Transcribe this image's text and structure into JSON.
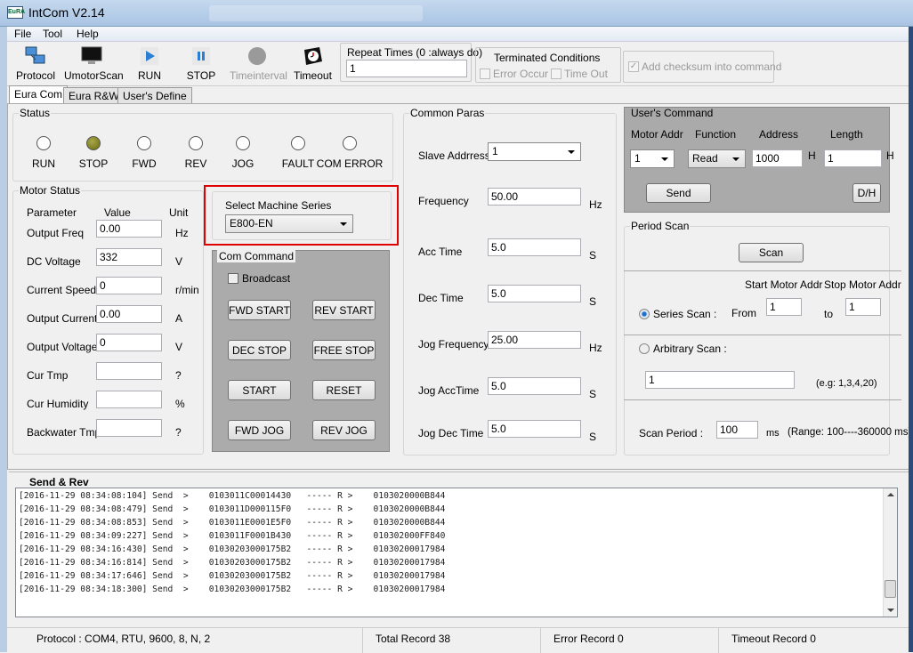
{
  "window": {
    "title": "IntCom V2.14",
    "logo_text": "EuRA"
  },
  "menu": [
    "File",
    "Tool",
    "Help"
  ],
  "toolbar": {
    "buttons": [
      {
        "label": "Protocol",
        "icon": "network-icon"
      },
      {
        "label": "UmotorScan",
        "icon": "monitor-icon"
      },
      {
        "label": "RUN",
        "icon": "play-icon"
      },
      {
        "label": "STOP",
        "icon": "pause-icon"
      },
      {
        "label": "Timeinterval",
        "icon": "circle-icon",
        "disabled": true
      },
      {
        "label": "Timeout",
        "icon": "clock-icon"
      }
    ],
    "repeat_label": "Repeat Times (0 :always do)",
    "repeat_value": "1",
    "terminated_label": "Terminated Conditions",
    "error_occur": "Error Occur",
    "time_out": "Time Out",
    "checksum_label": "Add checksum into command",
    "checksum_checked": true
  },
  "tabs": [
    "Eura Com",
    "Eura R&W",
    "User's Define"
  ],
  "status": {
    "title": "Status",
    "leds": [
      {
        "label": "RUN",
        "on": false
      },
      {
        "label": "STOP",
        "on": true
      },
      {
        "label": "FWD",
        "on": false
      },
      {
        "label": "REV",
        "on": false
      },
      {
        "label": "JOG",
        "on": false
      },
      {
        "label": "FAULT",
        "on": false
      },
      {
        "label": "COM ERROR",
        "on": false
      }
    ],
    "on_color": "#7a7a18"
  },
  "motor_status": {
    "title": "Motor Status",
    "headers": [
      "Parameter",
      "Value",
      "Unit"
    ],
    "rows": [
      {
        "name": "Output Freq",
        "value": "0.00",
        "unit": "Hz"
      },
      {
        "name": "DC Voltage",
        "value": "332",
        "unit": "V"
      },
      {
        "name": "Current Speed",
        "value": "0",
        "unit": "r/min"
      },
      {
        "name": "Output Current",
        "value": "0.00",
        "unit": "A"
      },
      {
        "name": "Output Voltage",
        "value": "0",
        "unit": "V"
      },
      {
        "name": "Cur Tmp",
        "value": "",
        "unit": "?"
      },
      {
        "name": "Cur Humidity",
        "value": "",
        "unit": "%"
      },
      {
        "name": "Backwater Tmp",
        "value": "",
        "unit": "?"
      }
    ]
  },
  "machine": {
    "label": "Select Machine Series",
    "value": "E800-EN",
    "highlight_color": "#e00000"
  },
  "com_command": {
    "title": "Com Command",
    "broadcast": "Broadcast",
    "buttons": [
      "FWD START",
      "REV START",
      "DEC STOP",
      "FREE STOP",
      "START",
      "RESET",
      "FWD JOG",
      "REV JOG"
    ]
  },
  "common_paras": {
    "title": "Common Paras",
    "rows": [
      {
        "name": "Slave  Addrress",
        "value": "1",
        "unit": "",
        "select": true
      },
      {
        "name": "Frequency",
        "value": "50.00",
        "unit": "Hz"
      },
      {
        "name": "Acc Time",
        "value": "5.0",
        "unit": "S"
      },
      {
        "name": "Dec Time",
        "value": "5.0",
        "unit": "S"
      },
      {
        "name": "Jog Frequency",
        "value": "25.00",
        "unit": "Hz"
      },
      {
        "name": "Jog AccTime",
        "value": "5.0",
        "unit": "S"
      },
      {
        "name": "Jog Dec Time",
        "value": "5.0",
        "unit": "S"
      }
    ]
  },
  "users_command": {
    "title": "User's Command",
    "motor_addr_label": "Motor Addr",
    "function_label": "Function",
    "address_label": "Address",
    "length_label": "Length",
    "motor_addr": "1",
    "function": "Read",
    "address": "1000",
    "length": "1",
    "h": "H",
    "send": "Send",
    "dh": "D/H"
  },
  "period_scan": {
    "title": "Period Scan",
    "scan": "Scan",
    "start_label": "Start Motor Addr",
    "stop_label": "Stop Motor Addr",
    "series_scan": "Series Scan :",
    "series_selected": true,
    "from": "From",
    "from_value": "1",
    "to": "to",
    "to_value": "1",
    "arbitrary_scan": "Arbitrary Scan :",
    "arbitrary_value": "1",
    "example": "(e.g: 1,3,4,20)",
    "period_label": "Scan Period :",
    "period_value": "100",
    "ms": "ms",
    "range": "(Range: 100----360000 ms)"
  },
  "log": {
    "title": "Send & Rev",
    "rows": [
      "[2016-11-29 08:34:08:104] Send  >    0103011C00014430   ----- R >    0103020000B844",
      "[2016-11-29 08:34:08:479] Send  >    0103011D000115F0   ----- R >    0103020000B844",
      "[2016-11-29 08:34:08:853] Send  >    0103011E0001E5F0   ----- R >    0103020000B844",
      "[2016-11-29 08:34:09:227] Send  >    0103011F0001B430   ----- R >    010302000FF840",
      "[2016-11-29 08:34:16:430] Send  >    01030203000175B2   ----- R >    01030200017984",
      "[2016-11-29 08:34:16:814] Send  >    01030203000175B2   ----- R >    01030200017984",
      "[2016-11-29 08:34:17:646] Send  >    01030203000175B2   ----- R >    01030200017984",
      "[2016-11-29 08:34:18:300] Send  >    01030203000175B2   ----- R >    01030200017984"
    ]
  },
  "statusbar": {
    "protocol": "Protocol :  COM4, RTU, 9600, 8, N, 2",
    "total": "Total Record   38",
    "error": "Error Record   0",
    "timeout": "Timeout Record   0"
  }
}
